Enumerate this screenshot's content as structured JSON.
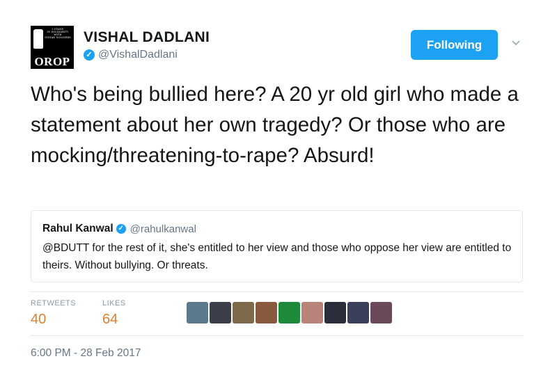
{
  "author": {
    "name": "VISHAL DADLANI",
    "handle": "@VishalDadlani",
    "verified": true,
    "avatar_text_small": "I STAND\nIN SOLIDARITY\nWITH\nINDIAN SOLDIERS",
    "avatar_text_large": "OROP"
  },
  "follow_button": {
    "label": "Following",
    "color": "#1da1f2"
  },
  "tweet": {
    "text": "Who's being bullied here? A 20 yr old girl who made a statement about her own tragedy? Or those who are mocking/threatening-to-rape? Absurd!"
  },
  "quoted_tweet": {
    "name": "Rahul Kanwal",
    "handle": "@rahulkanwal",
    "verified": true,
    "text": "@BDUTT for the rest of it, she's entitled to her view and those who oppose her view are entitled to theirs. Without bullying. Or threats."
  },
  "stats": {
    "retweets_label": "RETWEETS",
    "retweets_value": "40",
    "likes_label": "LIKES",
    "likes_value": "64",
    "value_color": "#e0802a"
  },
  "likers": [
    {
      "name": "liker-avatar-1",
      "color": "#5a7a8c"
    },
    {
      "name": "liker-avatar-2",
      "color": "#3b3f4a"
    },
    {
      "name": "liker-avatar-3",
      "color": "#7d6a4a"
    },
    {
      "name": "liker-avatar-4",
      "color": "#8a5a3e"
    },
    {
      "name": "liker-avatar-5",
      "color": "#1d8a3a"
    },
    {
      "name": "liker-avatar-6",
      "color": "#b8847a"
    },
    {
      "name": "liker-avatar-7",
      "color": "#2a2e3a"
    },
    {
      "name": "liker-avatar-8",
      "color": "#3a3f5a"
    },
    {
      "name": "liker-avatar-9",
      "color": "#6a4a5a"
    }
  ],
  "timestamp": "6:00 PM - 28 Feb 2017"
}
